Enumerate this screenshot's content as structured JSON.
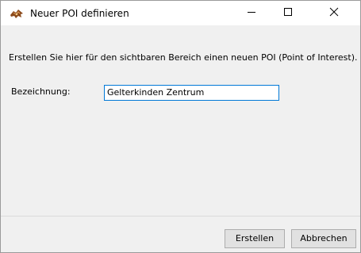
{
  "window": {
    "title": "Neuer POI definieren",
    "icon": "map-pin-app-icon"
  },
  "titlebar_buttons": {
    "minimize": "minimize-icon",
    "maximize": "maximize-icon",
    "close": "close-icon"
  },
  "dialog": {
    "description": "Erstellen Sie hier für den sichtbaren Bereich einen neuen POI (Point of Interest).",
    "name_label": "Bezeichnung:",
    "name_value": "Gelterkinden Zentrum"
  },
  "buttons": {
    "create_label": "Erstellen",
    "cancel_label": "Abbrechen"
  },
  "colors": {
    "window_bg": "#f0f0f0",
    "titlebar_bg": "#ffffff",
    "focus_border": "#0078d7",
    "button_bg": "#e1e1e1",
    "icon_brown": "#8b4a1c"
  }
}
